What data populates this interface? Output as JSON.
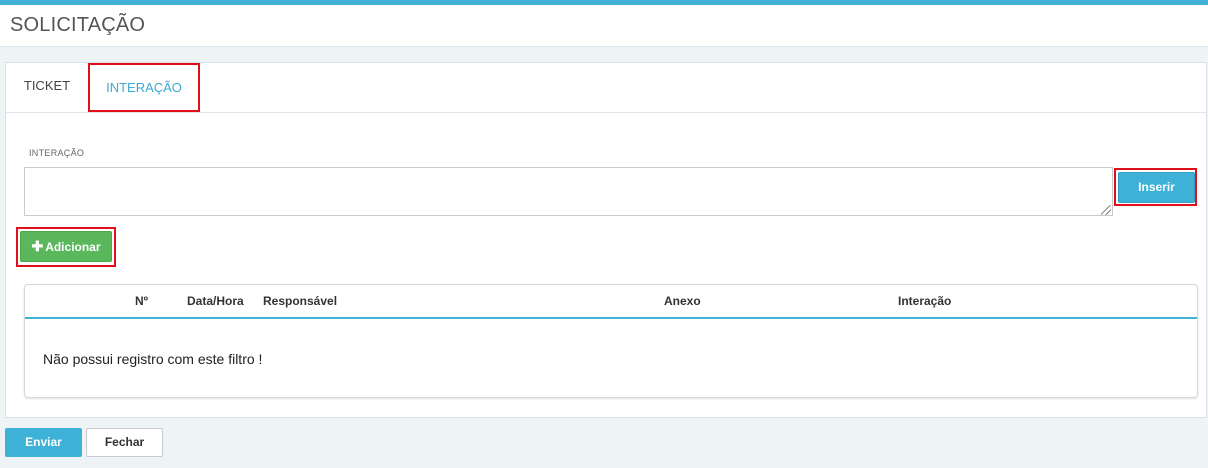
{
  "header": {
    "title": "SOLICITAÇÃO"
  },
  "tabs": [
    {
      "label": "TICKET",
      "active": false
    },
    {
      "label": "INTERAÇÃO",
      "active": true
    }
  ],
  "form": {
    "field_label": "INTERAÇÃO",
    "field_value": "",
    "insert_label": "Inserir",
    "add_label": "Adicionar"
  },
  "table": {
    "columns": [
      "Nº",
      "Data/Hora",
      "Responsável",
      "Anexo",
      "Interação"
    ],
    "empty_message": "Não possui registro com este filtro !"
  },
  "footer": {
    "send_label": "Enviar",
    "close_label": "Fechar"
  },
  "colors": {
    "accent": "#3fb0d6",
    "success": "#5bb75b",
    "highlight": "#e0101a"
  },
  "icons": {
    "add": "plus-icon"
  }
}
